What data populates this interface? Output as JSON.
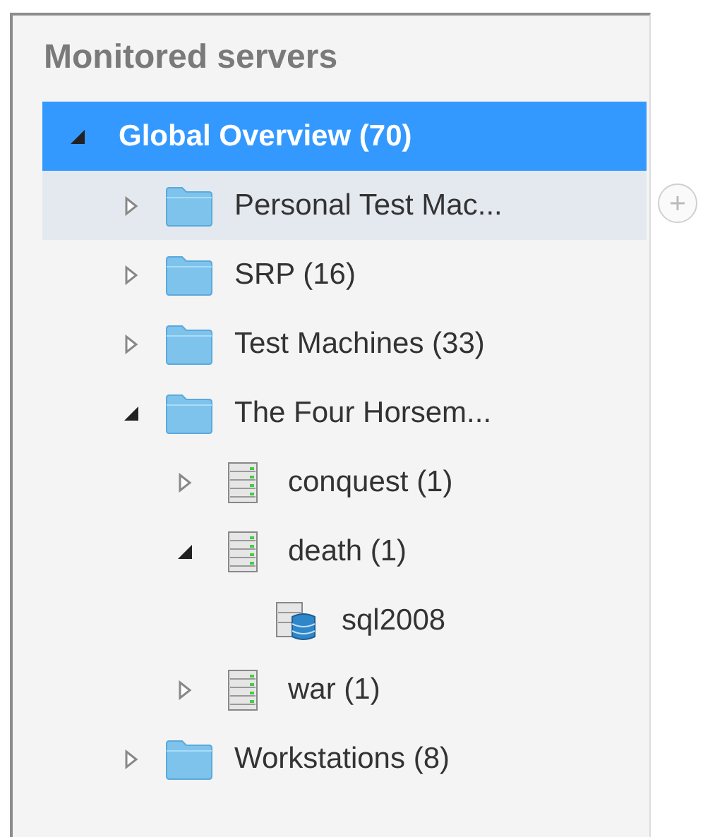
{
  "panel": {
    "title": "Monitored servers"
  },
  "tree": [
    {
      "label": "Global Overview (70)",
      "kind": "root",
      "expanded": true,
      "selected": true,
      "hovered": false,
      "children": [
        {
          "label": "Personal Test Mac...",
          "kind": "folder",
          "expanded": false,
          "selected": false,
          "hovered": true
        },
        {
          "label": "SRP (16)",
          "kind": "folder",
          "expanded": false,
          "selected": false,
          "hovered": false
        },
        {
          "label": "Test Machines (33)",
          "kind": "folder",
          "expanded": false,
          "selected": false,
          "hovered": false
        },
        {
          "label": "The Four Horsem...",
          "kind": "folder",
          "expanded": true,
          "selected": false,
          "hovered": false,
          "children": [
            {
              "label": "conquest (1)",
              "kind": "server",
              "expanded": false,
              "selected": false,
              "hovered": false
            },
            {
              "label": "death (1)",
              "kind": "server",
              "expanded": true,
              "selected": false,
              "hovered": false,
              "children": [
                {
                  "label": "sql2008",
                  "kind": "database",
                  "selected": false,
                  "hovered": false
                }
              ]
            },
            {
              "label": "war (1)",
              "kind": "server",
              "expanded": false,
              "selected": false,
              "hovered": false
            }
          ]
        },
        {
          "label": "Workstations (8)",
          "kind": "folder",
          "expanded": false,
          "selected": false,
          "hovered": false
        }
      ]
    }
  ]
}
